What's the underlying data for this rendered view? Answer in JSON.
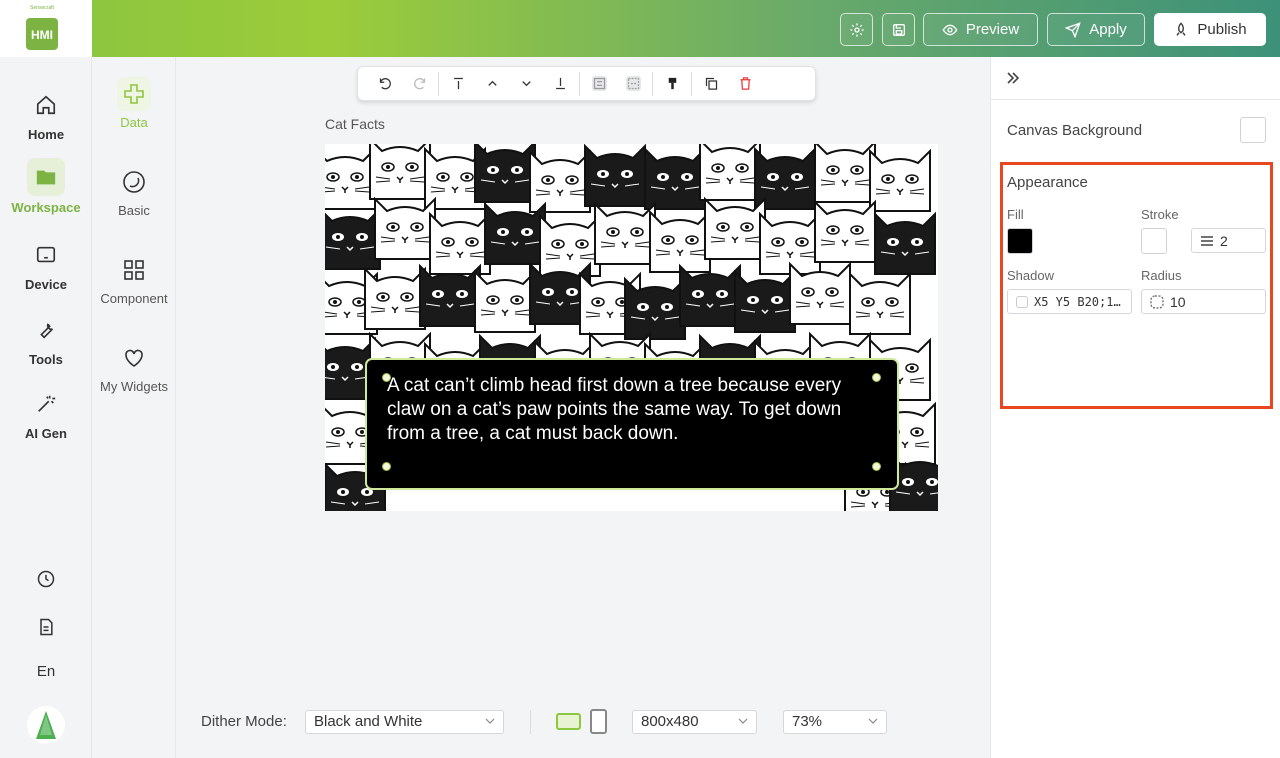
{
  "brand": {
    "small": "Sensecraft",
    "name": "HMI"
  },
  "header": {
    "preview_label": "Preview",
    "apply_label": "Apply",
    "publish_label": "Publish"
  },
  "rail": {
    "items": [
      {
        "label": "Home",
        "icon": "home-icon"
      },
      {
        "label": "Workspace",
        "icon": "folder-icon"
      },
      {
        "label": "Device",
        "icon": "device-icon"
      },
      {
        "label": "Tools",
        "icon": "wrench-icon"
      },
      {
        "label": "AI Gen",
        "icon": "magic-wand-icon"
      }
    ],
    "language": "En"
  },
  "subpanel": {
    "items": [
      {
        "label": "Data",
        "icon": "data-icon"
      },
      {
        "label": "Basic",
        "icon": "circle-icon"
      },
      {
        "label": "Component",
        "icon": "grid-icon"
      },
      {
        "label": "My Widgets",
        "icon": "heart-icon"
      }
    ]
  },
  "canvas": {
    "title": "Cat Facts",
    "text": "A cat can’t climb head first down a tree because every claw on a cat’s paw points the same way. To get down from a tree, a cat must back down."
  },
  "bottom": {
    "dither_label": "Dither Mode:",
    "dither_value": "Black and White",
    "resolution": "800x480",
    "zoom": "73%"
  },
  "properties": {
    "canvas_background_label": "Canvas Background",
    "appearance_label": "Appearance",
    "fill_label": "Fill",
    "stroke_label": "Stroke",
    "stroke_width": "2",
    "shadow_label": "Shadow",
    "shadow_value": "X5 Y5 B20;1…",
    "radius_label": "Radius",
    "radius_value": "10"
  },
  "colors": {
    "accent": "#7cb342",
    "highlight": "#e9471f",
    "fill": "#000000"
  }
}
